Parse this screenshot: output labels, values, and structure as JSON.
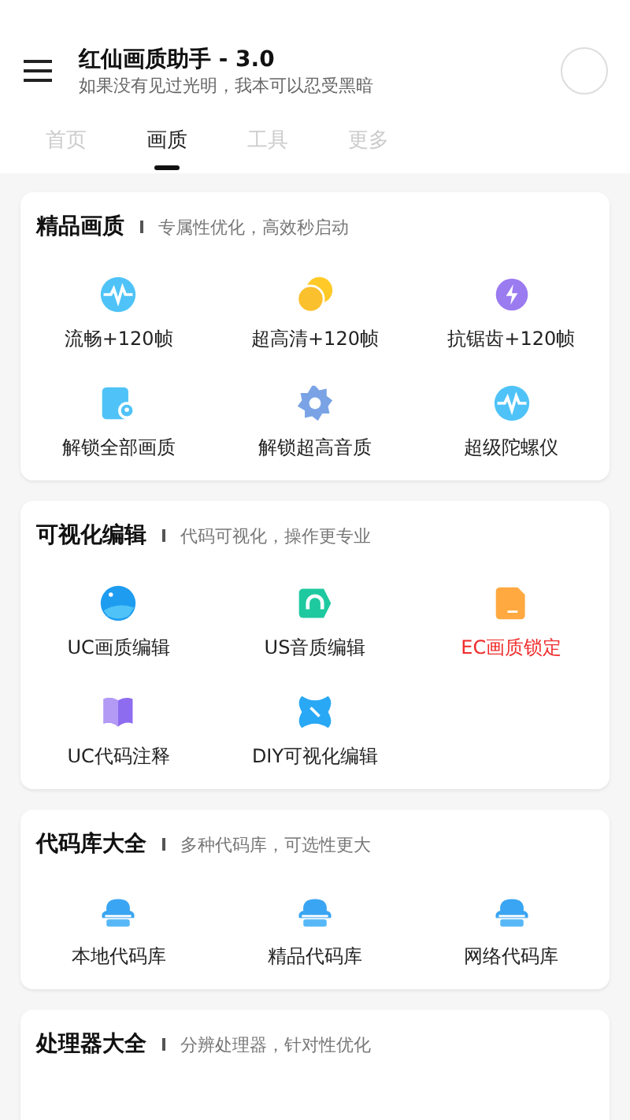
{
  "header": {
    "title": "红仙画质助手 - 3.0",
    "subtitle": "如果没有见过光明，我本可以忍受黑暗"
  },
  "tabs": [
    {
      "label": "首页",
      "selected": false
    },
    {
      "label": "画质",
      "selected": true
    },
    {
      "label": "工具",
      "selected": false
    },
    {
      "label": "更多",
      "selected": false
    }
  ],
  "sections": [
    {
      "title": "精品画质",
      "subtitle": "专属性优化，高效秒启动",
      "items": [
        {
          "label": "流畅+120帧",
          "highlighted": false
        },
        {
          "label": "超高清+120帧",
          "highlighted": false
        },
        {
          "label": "抗锯齿+120帧",
          "highlighted": false
        },
        {
          "label": "解锁全部画质",
          "highlighted": false
        },
        {
          "label": "解锁超高音质",
          "highlighted": false
        },
        {
          "label": "超级陀螺仪",
          "highlighted": false
        }
      ]
    },
    {
      "title": "可视化编辑",
      "subtitle": "代码可视化，操作更专业",
      "items": [
        {
          "label": "UC画质编辑",
          "highlighted": false
        },
        {
          "label": "US音质编辑",
          "highlighted": false
        },
        {
          "label": "EC画质锁定",
          "highlighted": true
        },
        {
          "label": "UC代码注释",
          "highlighted": false
        },
        {
          "label": "DIY可视化编辑",
          "highlighted": false
        }
      ]
    },
    {
      "title": "代码库大全",
      "subtitle": "多种代码库，可选性更大",
      "items": [
        {
          "label": "本地代码库",
          "highlighted": false
        },
        {
          "label": "精品代码库",
          "highlighted": false
        },
        {
          "label": "网络代码库",
          "highlighted": false
        }
      ]
    },
    {
      "title": "处理器大全",
      "subtitle": "分辨处理器，针对性优化"
    }
  ]
}
